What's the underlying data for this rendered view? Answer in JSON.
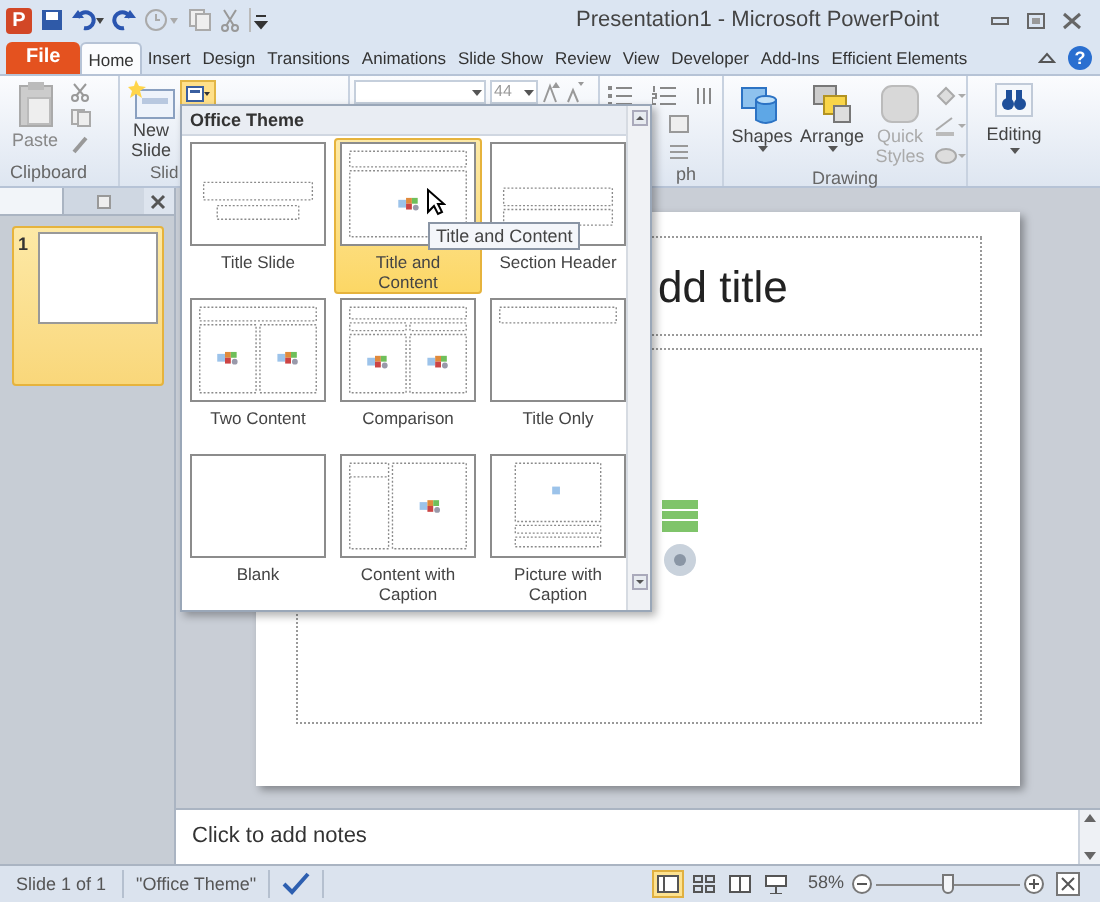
{
  "window": {
    "app_icon": "P",
    "title": "Presentation1 - Microsoft PowerPoint"
  },
  "tabs": [
    {
      "label": "File",
      "kind": "file",
      "selected": false
    },
    {
      "label": "Home",
      "kind": "tab",
      "selected": true
    },
    {
      "label": "Insert",
      "kind": "tab",
      "selected": false
    },
    {
      "label": "Design",
      "kind": "tab",
      "selected": false
    },
    {
      "label": "Transitions",
      "kind": "tab",
      "selected": false
    },
    {
      "label": "Animations",
      "kind": "tab",
      "selected": false
    },
    {
      "label": "Slide Show",
      "kind": "tab",
      "selected": false
    },
    {
      "label": "Review",
      "kind": "tab",
      "selected": false
    },
    {
      "label": "View",
      "kind": "tab",
      "selected": false
    },
    {
      "label": "Developer",
      "kind": "tab",
      "selected": false
    },
    {
      "label": "Add-Ins",
      "kind": "tab",
      "selected": false
    },
    {
      "label": "Efficient Elements",
      "kind": "tab",
      "selected": false
    }
  ],
  "help": "?",
  "ribbon": {
    "paste": "Paste",
    "new_slide": "New",
    "new_slide_2": "Slide",
    "font_size": "44",
    "shapes": "Shapes",
    "arrange": "Arrange",
    "quick_styles": "Quick",
    "quick_styles_2": "Styles",
    "editing": "Editing",
    "group_labels": [
      "Clipboard",
      "Slid",
      "ph",
      "Drawing"
    ]
  },
  "layout_gallery": {
    "header": "Office Theme",
    "layouts": [
      {
        "label": "Title Slide",
        "kind": "title",
        "selected": false
      },
      {
        "label": "Title and Content",
        "kind": "title_content",
        "selected": true
      },
      {
        "label": "Section Header",
        "kind": "section_header",
        "selected": false
      },
      {
        "label": "Two Content",
        "kind": "two_content",
        "selected": false
      },
      {
        "label": "Comparison",
        "kind": "comparison",
        "selected": false
      },
      {
        "label": "Title Only",
        "kind": "title_only",
        "selected": false
      },
      {
        "label": "Blank",
        "kind": "blank",
        "selected": false
      },
      {
        "label": "Content with Caption",
        "kind": "content_caption",
        "selected": false
      },
      {
        "label": "Picture with Caption",
        "kind": "picture_caption",
        "selected": false
      }
    ]
  },
  "tooltip": "Title and Content",
  "slide_panel": {
    "thumbnails": [
      {
        "number": "1",
        "selected": true
      }
    ]
  },
  "slide": {
    "title": "dd title"
  },
  "notes": {
    "placeholder": "Click to add notes"
  },
  "status_bar": {
    "slide": "Slide 1 of 1",
    "theme": "\"Office Theme\"",
    "views": [
      {
        "selected": true
      },
      {
        "selected": false
      },
      {
        "selected": false
      },
      {
        "selected": false
      }
    ],
    "zoom": "58%",
    "zoom_slider": {
      "level": 0.5
    }
  }
}
